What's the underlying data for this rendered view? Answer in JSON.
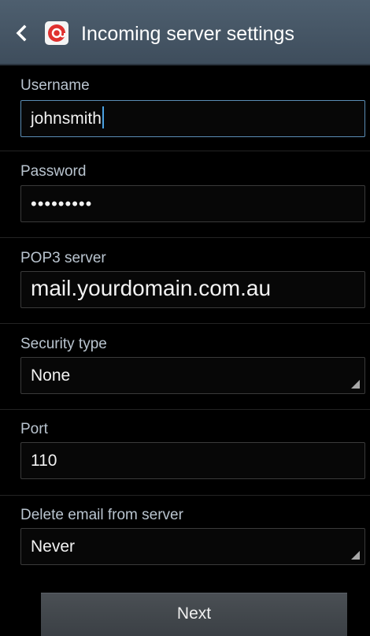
{
  "header": {
    "title": "Incoming server settings",
    "back_icon": "chevron-left-icon",
    "app_icon": "email-at-icon",
    "app_icon_color": "#e0302f"
  },
  "fields": {
    "username": {
      "label": "Username",
      "value": "johnsmith"
    },
    "password": {
      "label": "Password",
      "value": "•••••••••"
    },
    "server": {
      "label": "POP3 server",
      "value": "mail.yourdomain.com.au"
    },
    "security": {
      "label": "Security type",
      "value": "None"
    },
    "port": {
      "label": "Port",
      "value": "110"
    },
    "delete": {
      "label": "Delete email from server",
      "value": "Never"
    }
  },
  "footer": {
    "next_label": "Next"
  },
  "colors": {
    "header_bg": "#46576a",
    "label": "#b9c4cf",
    "focus": "#5b8db5"
  }
}
